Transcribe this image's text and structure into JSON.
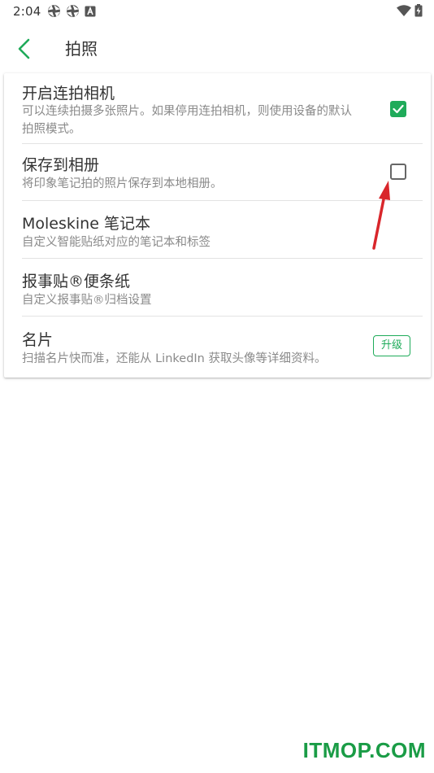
{
  "status_bar": {
    "time": "2:04"
  },
  "header": {
    "title": "拍照"
  },
  "settings": [
    {
      "title": "开启连拍相机",
      "subtitle_lines": [
        "可以连续拍摄多张照片。如果停用连拍相机，则使用设备的默认",
        "拍照模式。"
      ],
      "control": "checkbox",
      "checked": true
    },
    {
      "title": "保存到相册",
      "subtitle_lines": [
        "将印象笔记拍的照片保存到本地相册。"
      ],
      "control": "checkbox",
      "checked": false
    },
    {
      "title": "Moleskine 笔记本",
      "subtitle_lines": [
        "自定义智能贴纸对应的笔记本和标签"
      ],
      "control": "none"
    },
    {
      "title": "报事贴®便条纸",
      "subtitle_lines": [
        "自定义报事贴®归档设置"
      ],
      "control": "none"
    },
    {
      "title": "名片",
      "subtitle_lines": [
        "扫描名片快而准，还能从 LinkedIn 获取头像等详细资料。"
      ],
      "control": "badge",
      "badge_label": "升级"
    }
  ],
  "colors": {
    "accent": "#1fab5a",
    "annotation_arrow": "#d9262b"
  },
  "watermark": "ITMOP.COM"
}
